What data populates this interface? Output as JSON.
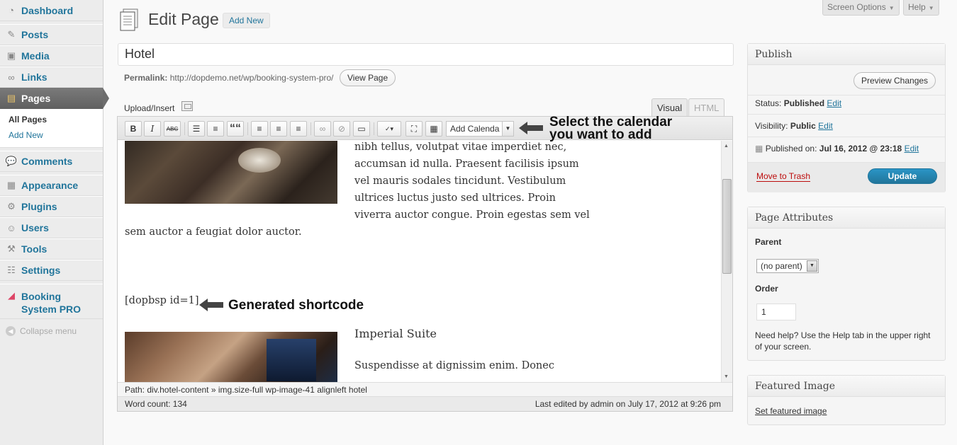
{
  "sidebar": {
    "items": [
      {
        "label": "Dashboard",
        "icon": "dashboard-icon"
      },
      {
        "label": "Posts",
        "icon": "pin-icon"
      },
      {
        "label": "Media",
        "icon": "media-icon"
      },
      {
        "label": "Links",
        "icon": "link-icon"
      },
      {
        "label": "Pages",
        "icon": "pages-icon"
      },
      {
        "label": "Comments",
        "icon": "comment-icon"
      },
      {
        "label": "Appearance",
        "icon": "appearance-icon"
      },
      {
        "label": "Plugins",
        "icon": "plugin-icon"
      },
      {
        "label": "Users",
        "icon": "users-icon"
      },
      {
        "label": "Tools",
        "icon": "tools-icon"
      },
      {
        "label": "Settings",
        "icon": "settings-icon"
      },
      {
        "label": "Booking System PRO",
        "icon": "booking-icon"
      }
    ],
    "submenu": {
      "all_pages": "All Pages",
      "add_new": "Add New"
    },
    "collapse": "Collapse menu"
  },
  "top": {
    "screen_options": "Screen Options",
    "help": "Help"
  },
  "header": {
    "title": "Edit Page",
    "add_new": "Add New"
  },
  "post": {
    "title": "Hotel",
    "permalink_label": "Permalink:",
    "permalink_url": "http://dopdemo.net/wp/booking-system-pro/",
    "view_page": "View Page"
  },
  "editor": {
    "upload_insert": "Upload/Insert",
    "tab_visual": "Visual",
    "tab_html": "HTML",
    "toolbar": {
      "bold": "B",
      "italic": "I",
      "strike": "ABC",
      "quote": "““",
      "add_calendar": "Add Calenda"
    },
    "content": {
      "para1_lines": [
        "nibh tellus, volutpat vitae imperdiet nec,",
        "accumsan id nulla. Praesent facilisis ipsum",
        "vel mauris sodales tincidunt. Vestibulum",
        "ultrices luctus justo sed ultrices. Proin",
        "viverra auctor congue. Proin egestas sem vel"
      ],
      "para1_tail": "sem auctor a feugiat dolor auctor.",
      "shortcode": "[dopbsp id=1]",
      "suite_title": "Imperial Suite",
      "suite_text": "Suspendisse at dignissim enim. Donec"
    },
    "path": "Path: div.hotel-content » img.size-full wp-image-41 alignleft hotel",
    "word_count": "Word count: 134",
    "last_edited": "Last edited by admin on July 17, 2012 at 9:26 pm"
  },
  "annotations": {
    "calendar_line1": "Select the calendar",
    "calendar_line2": "you want to add",
    "shortcode": "Generated shortcode"
  },
  "publish": {
    "title": "Publish",
    "preview_changes": "Preview Changes",
    "status_label": "Status:",
    "status_value": "Published",
    "visibility_label": "Visibility:",
    "visibility_value": "Public",
    "published_on_label": "Published on:",
    "published_on_value": "Jul 16, 2012 @ 23:18",
    "edit": "Edit",
    "move_to_trash": "Move to Trash",
    "update": "Update"
  },
  "page_attributes": {
    "title": "Page Attributes",
    "parent_label": "Parent",
    "parent_value": "(no parent)",
    "order_label": "Order",
    "order_value": "1",
    "help_line1": "Need help? Use the Help tab in the upper right",
    "help_line2": "of your screen."
  },
  "featured_image": {
    "title": "Featured Image",
    "set_link": "Set featured image"
  },
  "colors": {
    "link": "#21759b",
    "primary": "#21759b",
    "trash": "#bc0b0b"
  }
}
